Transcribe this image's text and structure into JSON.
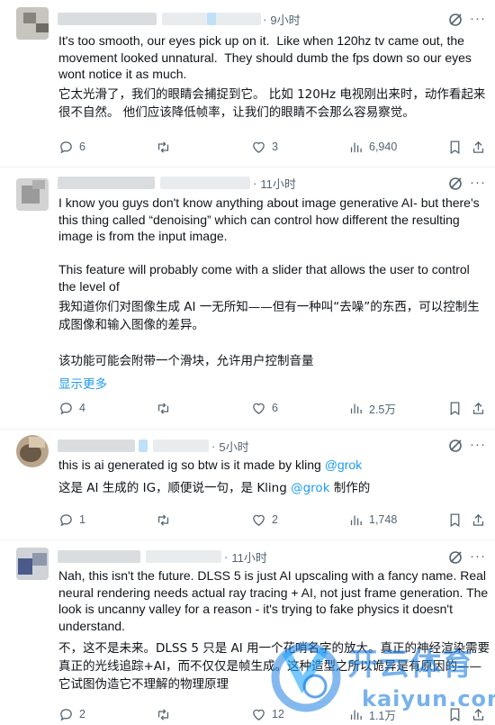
{
  "tweets": [
    {
      "time": "9小时",
      "text_en": "It's too smooth, our eyes pick up on it.  Like when 120hz tv came out, the movement looked unnatural.  They should dumb the fps down so our eyes wont notice it as much.",
      "text_zh": "它太光滑了，我们的眼睛会捕捉到它。 比如 120Hz 电视刚出来时，动作看起来很不自然。 他们应该降低帧率，让我们的眼睛不会那么容易察觉。",
      "replies": "6",
      "retweets": "",
      "likes": "3",
      "views": "6,940"
    },
    {
      "time": "11小时",
      "text_en": "I know you guys don't know anything about image generative AI- but there's this thing called “denoising” which can control how different the resulting image is from the input image.\n\nThis feature will probably come with a slider that allows the user to control the level of",
      "text_zh": "我知道你们对图像生成 AI 一无所知——但有一种叫“去噪”的东西，可以控制生成图像和输入图像的差异。\n\n该功能可能会附带一个滑块，允许用户控制音量",
      "show_more": "显示更多",
      "replies": "4",
      "retweets": "",
      "likes": "6",
      "views": "2.5万"
    },
    {
      "time": "5小时",
      "text_en": "this is ai generated ig so btw is it made by kling ",
      "mention_en": "@grok",
      "text_zh": "这是 AI 生成的 IG，顺便说一句，是 Kling ",
      "mention_zh": "@grok",
      "text_zh_tail": " 制作的",
      "replies": "1",
      "retweets": "",
      "likes": "2",
      "views": "1,748"
    },
    {
      "time": "11小时",
      "text_en": "Nah, this isn't the future. DLSS 5 is just AI upscaling with a fancy name. Real neural rendering needs actual ray tracing + AI, not just frame generation. The look is uncanny valley for a reason - it's trying to fake physics it doesn't understand.",
      "text_zh": "不，这不是未来。DLSS 5 只是 AI 用一个花哨名字的放大。真正的神经渲染需要真正的光线追踪+AI，而不仅仅是帧生成。这种造型之所以诡异是有原因的——它试图伪造它不理解的物理原理",
      "replies": "2",
      "retweets": "",
      "likes": "12",
      "views": "1.1万"
    }
  ],
  "watermark": {
    "brand": "开云体育",
    "domain": "kaiyun.com"
  },
  "colors": {
    "text": "#0f1419",
    "muted": "#536471",
    "link": "#1d9bf0",
    "divider": "#eff3f4"
  },
  "icons": [
    "reply-icon",
    "retweet-icon",
    "like-icon",
    "views-icon",
    "bookmark-icon",
    "share-icon",
    "grok-icon",
    "more-icon"
  ]
}
